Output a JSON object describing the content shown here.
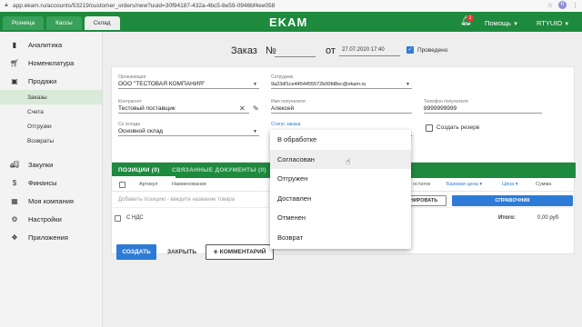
{
  "browser": {
    "url": "app.ekam.ru/accounts/53219/customer_orders/new?uuid=30f94187-432a-4bc5-8e59-0946bf4ee058",
    "profile_initial": "R"
  },
  "header": {
    "tabs": [
      {
        "label": "Розница"
      },
      {
        "label": "Кассы"
      },
      {
        "label": "Склад"
      }
    ],
    "logo": "EKAM",
    "notifications_count": "1",
    "help_label": "Помощь",
    "account_label": "RTYUIO"
  },
  "sidebar": {
    "items": [
      {
        "label": "Аналитика",
        "icon": "bar-chart-icon"
      },
      {
        "label": "Номенклатура",
        "icon": "cart-icon"
      },
      {
        "label": "Продажи",
        "icon": "briefcase-icon"
      }
    ],
    "sub_items": [
      {
        "label": "Заказы"
      },
      {
        "label": "Счета"
      },
      {
        "label": "Отгрузки"
      },
      {
        "label": "Возвраты"
      }
    ],
    "items_after": [
      {
        "label": "Закупки",
        "icon": "truck-icon"
      },
      {
        "label": "Финансы",
        "icon": "dollar-icon"
      },
      {
        "label": "Моя компания",
        "icon": "company-icon"
      },
      {
        "label": "Настройки",
        "icon": "gear-icon"
      },
      {
        "label": "Приложения",
        "icon": "apps-icon"
      }
    ]
  },
  "order": {
    "title": "Заказ",
    "number_sign": "№",
    "number_value": "",
    "from_label": "от",
    "date_value": "27.07.2020 17:40",
    "posted_label": "Проведено",
    "posted_checked": true
  },
  "form": {
    "organization": {
      "label": "Организация",
      "value": "ООО \"ТЕСТОВАЯ КОМПАНИЯ\""
    },
    "employee": {
      "label": "Сотрудник",
      "value": "9a23df1ce4454455572b00fd8ec@ekam.ru"
    },
    "contractor": {
      "label": "Контрагент",
      "value": "Тестовый поставщик"
    },
    "receiver_name": {
      "label": "Имя получателя",
      "value": "Алексей"
    },
    "receiver_phone": {
      "label": "Телефон получателя",
      "value": "8999999999"
    },
    "warehouse": {
      "label": "Со склада",
      "value": "Основной склад"
    },
    "status": {
      "label": "Статус заказа",
      "value": ""
    },
    "create_reserve_label": "Создать резерв"
  },
  "status_dropdown": {
    "options": [
      {
        "label": "В обработке"
      },
      {
        "label": "Согласован"
      },
      {
        "label": "Отгружен"
      },
      {
        "label": "Доставлен"
      },
      {
        "label": "Отменен"
      },
      {
        "label": "Возврат"
      }
    ],
    "hovered_index": 1
  },
  "positions": {
    "tab_positions": "ПОЗИЦИИ (0)",
    "tab_documents": "СВЯЗАННЫЕ ДОКУМЕНТЫ (0)",
    "columns": {
      "article": "Артикул",
      "name": "Наименование",
      "balance": "остаток",
      "base_price": "Базовая цена",
      "price": "Цена",
      "sum": "Сумма"
    },
    "add_hint": "Добавить позицию - введите название товара",
    "btn_import": "НИРОВАТЬ",
    "btn_reference": "СПРАВОЧНИК",
    "vat_label": "С НДС",
    "total_label": "Итого:",
    "total_value": "0,00 руб"
  },
  "actions": {
    "create": "СОЗДАТЬ",
    "close": "ЗАКРЫТЬ",
    "comment": "КОММЕНТАРИЙ"
  },
  "colors": {
    "brand_green": "#1e8a3e",
    "accent_blue": "#2d7bd6"
  }
}
